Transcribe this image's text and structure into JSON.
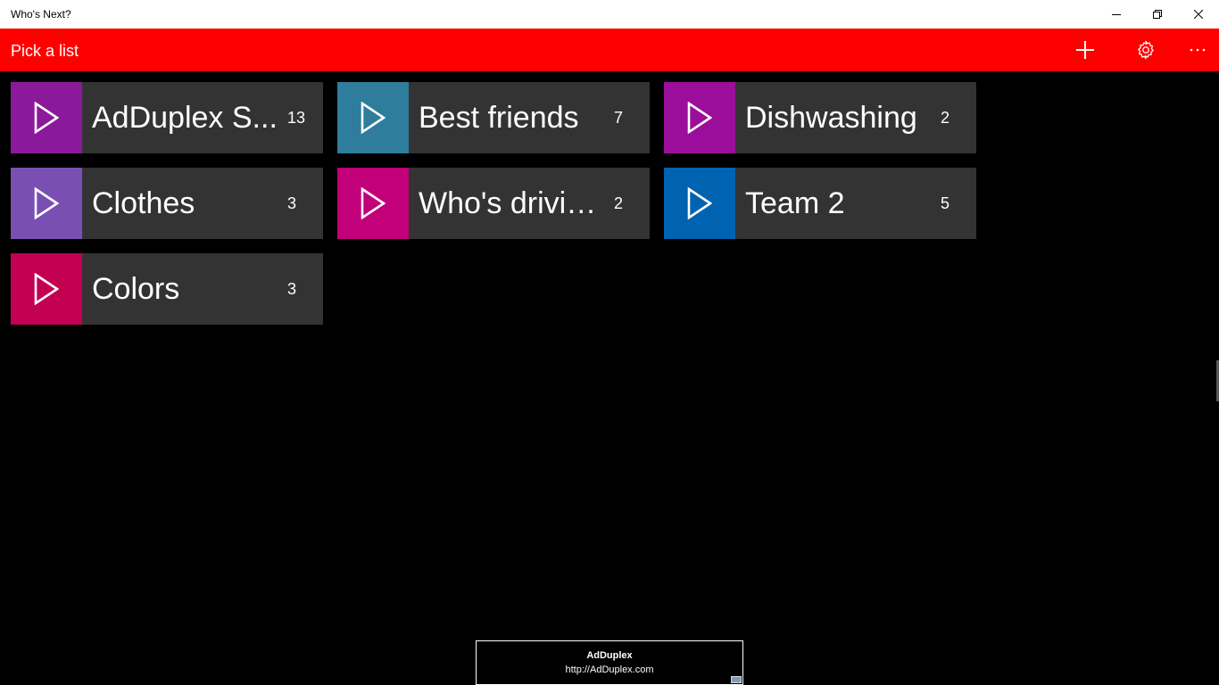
{
  "window": {
    "title": "Who's Next?"
  },
  "appbar": {
    "heading": "Pick a list",
    "add_icon": "plus-icon",
    "settings_icon": "gear-icon",
    "more_icon": "ellipsis-icon"
  },
  "lists": [
    {
      "name": "AdDuplex S...",
      "count": "13",
      "color": "#8b1a9a"
    },
    {
      "name": "Best friends",
      "count": "7",
      "color": "#2e7d9c"
    },
    {
      "name": "Dishwashing",
      "count": "2",
      "color": "#9b0e9b"
    },
    {
      "name": "Clothes",
      "count": "3",
      "color": "#7a4fb4"
    },
    {
      "name": "Who's drivin...",
      "count": "2",
      "color": "#c2007a"
    },
    {
      "name": "Team 2",
      "count": "5",
      "color": "#0063b1"
    },
    {
      "name": "Colors",
      "count": "3",
      "color": "#c30052"
    }
  ],
  "ad": {
    "title": "AdDuplex",
    "url": "http://AdDuplex.com"
  }
}
